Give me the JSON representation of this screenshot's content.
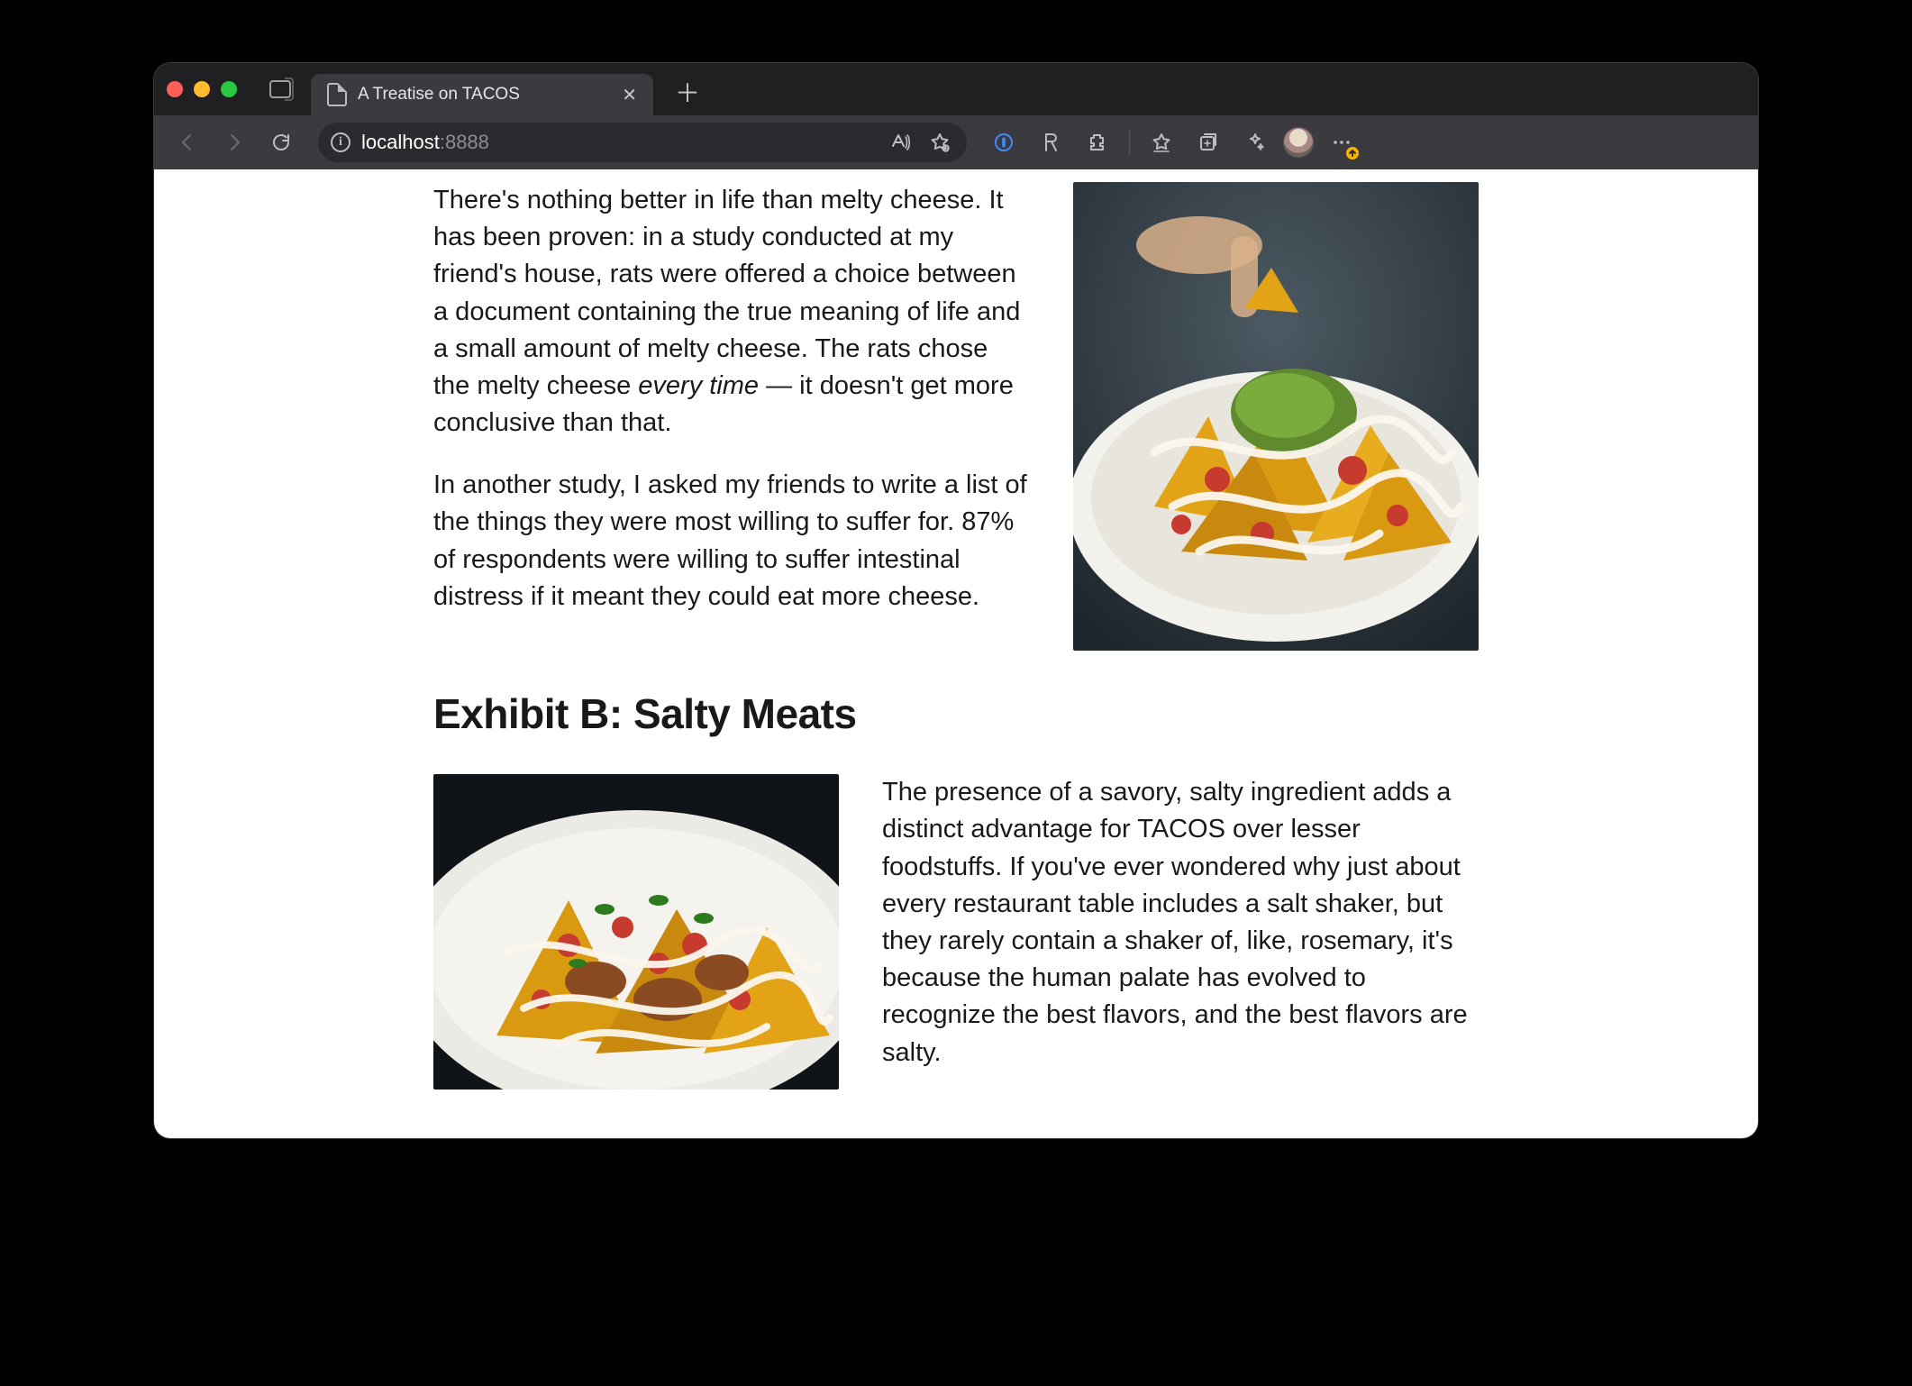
{
  "browser": {
    "tab_title": "A Treatise on TACOS",
    "address_host": "localhost",
    "address_port": ":8888"
  },
  "article": {
    "p1_a": "There's nothing better in life than melty cheese. It has been proven: in a study conducted at my friend's house, rats were offered a choice between a document containing the true meaning of life and a small amount of melty cheese. The rats chose the melty cheese ",
    "p1_em": "every time",
    "p1_b": " — it doesn't get more conclusive than that.",
    "p2": "In another study, I asked my friends to write a list of the things they were most willing to suffer for. 87% of respondents were willing to suffer intestinal distress if it meant they could eat more cheese.",
    "h2": "Exhibit B: Salty Meats",
    "p3": "The presence of a savory, salty ingredient adds a distinct advantage for TACOS over lesser foodstuffs. If you've ever wondered why just about every restaurant table includes a salt shaker, but they rarely contain a shaker of, like, rosemary, it's because the human palate has evolved to recognize the best flavors, and the best flavors are salty."
  }
}
